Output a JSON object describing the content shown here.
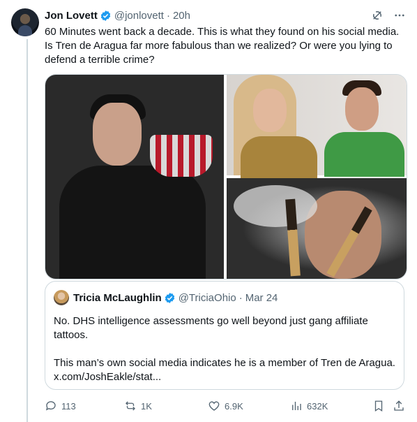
{
  "tweet": {
    "author_name": "Jon Lovett",
    "handle": "@jonlovett",
    "separator": "·",
    "time": "20h",
    "text": "60 Minutes went back a decade. This is what they found on his social media. Is Tren de Aragua far more fabulous than we realized? Or were you lying to defend a terrible crime?"
  },
  "quoted": {
    "author_name": "Tricia McLaughlin",
    "handle": "@TriciaOhio",
    "separator": "·",
    "date": "Mar 24",
    "text": "No. DHS intelligence assessments go well beyond just gang affiliate tattoos.\n\nThis man’s own social media indicates he is a member of Tren de Aragua.",
    "link": "x.com/JoshEakle/stat..."
  },
  "actions": {
    "replies": "113",
    "reposts": "1K",
    "likes": "6.9K",
    "views": "632K"
  },
  "colors": {
    "verified": "#1d9bf0",
    "muted": "#536471",
    "border": "#cfd9de"
  },
  "icons": [
    "grok-icon",
    "more-icon",
    "verified-badge-icon",
    "reply-icon",
    "repost-icon",
    "like-icon",
    "views-icon",
    "bookmark-icon",
    "share-icon"
  ]
}
